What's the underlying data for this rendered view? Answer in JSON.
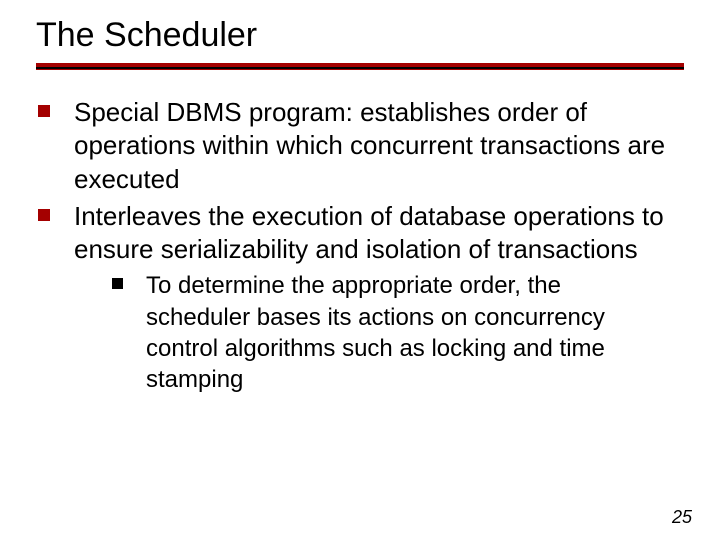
{
  "title": "The Scheduler",
  "bullets": {
    "b1": "Special DBMS program: establishes order of operations within which concurrent transactions are executed",
    "b2": "Interleaves the execution of database operations to ensure serializability and isolation of transactions",
    "b2_sub1": "To determine the appropriate order, the scheduler bases its actions on concurrency control algorithms such as locking and time stamping"
  },
  "page_number": "25",
  "colors": {
    "accent_red": "#a40000",
    "black": "#000000"
  }
}
